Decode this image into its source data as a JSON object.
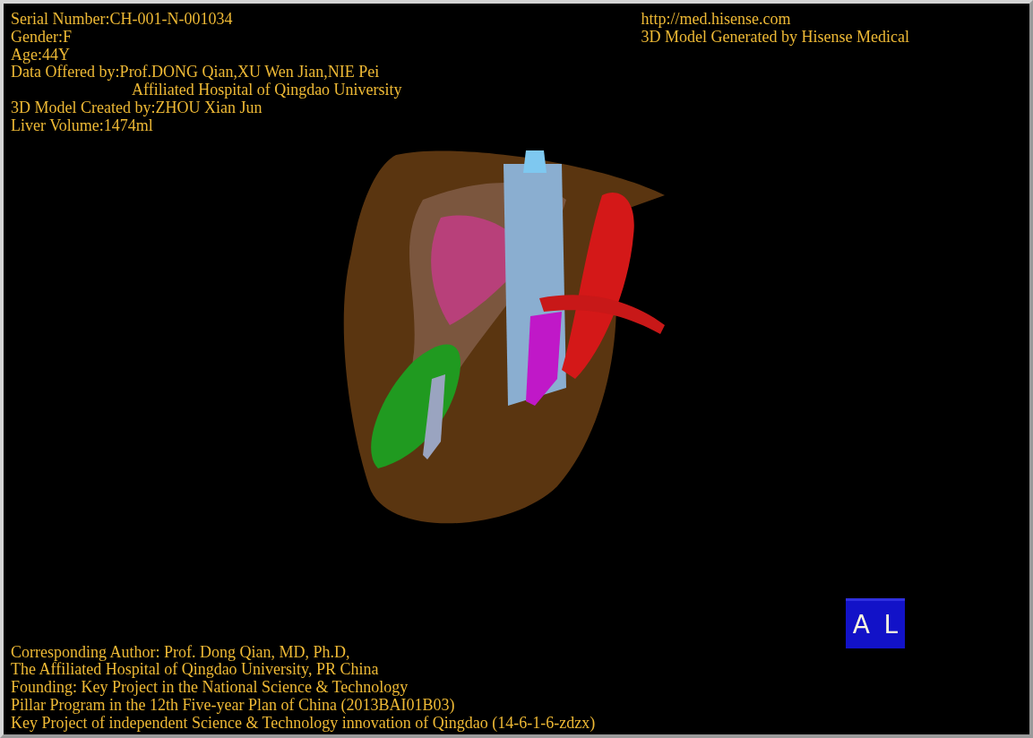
{
  "info_top_left": [
    {
      "kind": "line",
      "text": "Serial Number:CH-001-N-001034"
    },
    {
      "kind": "line",
      "text": "Gender:F"
    },
    {
      "kind": "line",
      "text": "Age:44Y"
    },
    {
      "kind": "line",
      "text": "Data Offered by:Prof.DONG Qian,XU Wen Jian,NIE Pei"
    },
    {
      "kind": "continuation",
      "text": "Affiliated Hospital of Qingdao University"
    },
    {
      "kind": "line",
      "text": "3D Model Created by:ZHOU Xian Jun"
    },
    {
      "kind": "line",
      "text": "Liver Volume:1474ml"
    }
  ],
  "info_top_right": [
    "http://med.hisense.com",
    "3D Model Generated by Hisense Medical"
  ],
  "orientation_cube": {
    "labels": [
      "A",
      "L"
    ]
  },
  "info_bottom_left": [
    "Corresponding Author: Prof. Dong Qian, MD, Ph.D,",
    "The Affiliated Hospital of Qingdao University, PR China",
    "Founding: Key Project in the National Science & Technology",
    "Pillar Program in the 12th Five-year Plan of China (2013BAI01B03)",
    "Key Project of independent Science & Technology innovation of Qingdao (14-6-1-6-zdzx)"
  ]
}
